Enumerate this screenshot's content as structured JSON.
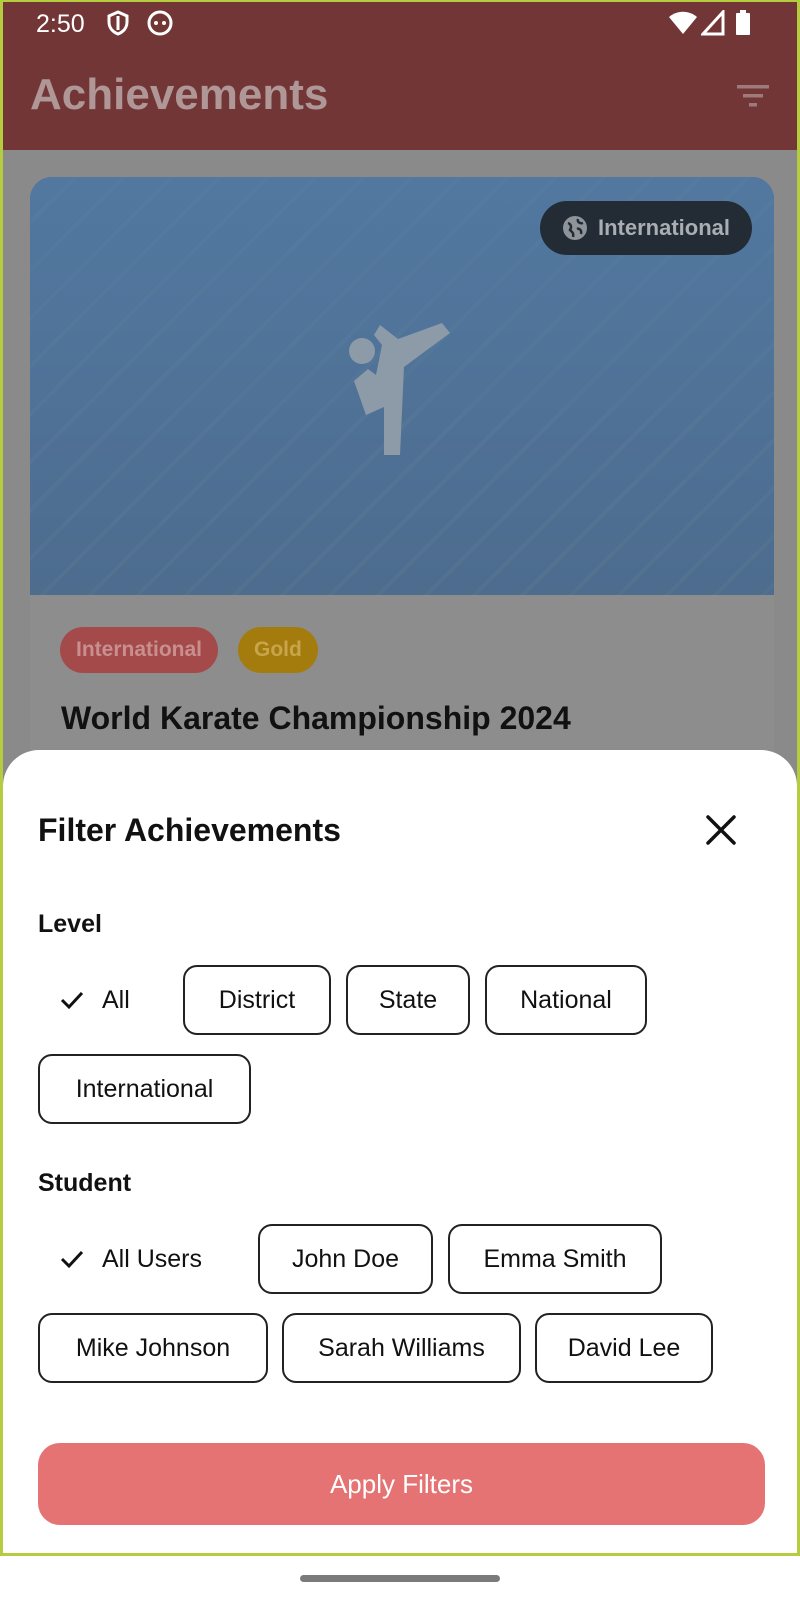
{
  "status_bar": {
    "time": "2:50"
  },
  "app_bar": {
    "title": "Achievements"
  },
  "card": {
    "badge": "International",
    "tags": [
      "International",
      "Gold"
    ],
    "title": "World Karate Championship 2024"
  },
  "filter_sheet": {
    "title": "Filter Achievements",
    "level": {
      "label": "Level",
      "options": [
        "All",
        "District",
        "State",
        "National",
        "International"
      ],
      "selected": "All"
    },
    "student": {
      "label": "Student",
      "options": [
        "All Users",
        "John Doe",
        "Emma Smith",
        "Mike Johnson",
        "Sarah Williams",
        "David Lee"
      ],
      "selected": "All Users"
    },
    "apply_label": "Apply Filters"
  },
  "colors": {
    "app_bar": "#733636",
    "apply_button": "#e57373",
    "accent_gold": "#a47c0e"
  }
}
